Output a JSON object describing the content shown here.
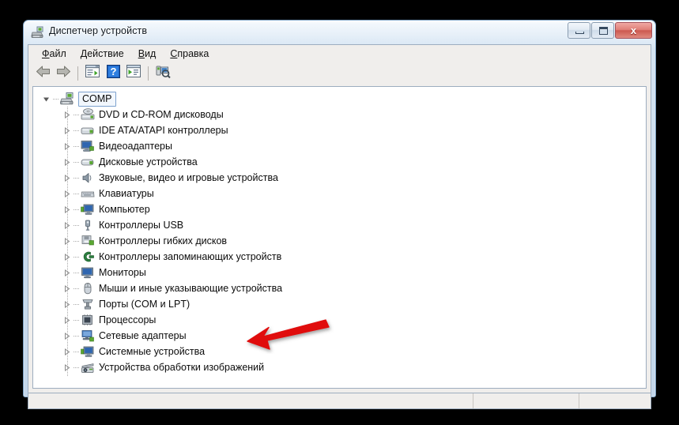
{
  "window": {
    "title": "Диспетчер устройств",
    "title_icon": "device-manager-icon",
    "buttons": {
      "minimize": "Свернуть",
      "maximize": "Развернуть",
      "close": "x"
    }
  },
  "menu": {
    "items": [
      {
        "label": "Файл",
        "accel": "Ф"
      },
      {
        "label": "Действие",
        "accel": "Д"
      },
      {
        "label": "Вид",
        "accel": "В"
      },
      {
        "label": "Справка",
        "accel": "С"
      }
    ]
  },
  "toolbar": {
    "items": [
      {
        "name": "back-button",
        "icon": "left-arrow-icon"
      },
      {
        "name": "forward-button",
        "icon": "right-arrow-icon"
      },
      {
        "name": "separator-1",
        "icon": "separator"
      },
      {
        "name": "properties-button",
        "icon": "properties-window-icon"
      },
      {
        "name": "help-button",
        "icon": "question-mark-icon"
      },
      {
        "name": "update-driver-button",
        "icon": "window-play-icon"
      },
      {
        "name": "separator-2",
        "icon": "separator"
      },
      {
        "name": "scan-hardware-changes-button",
        "icon": "scan-hardware-icon"
      }
    ]
  },
  "tree": {
    "root": {
      "label": "COMP",
      "icon": "computer-icon",
      "expanded": true,
      "selected": true
    },
    "children": [
      {
        "label": "DVD и CD-ROM дисководы",
        "icon": "dvd-drive-icon"
      },
      {
        "label": "IDE ATA/ATAPI контроллеры",
        "icon": "ide-controller-icon"
      },
      {
        "label": "Видеоадаптеры",
        "icon": "display-adapter-icon"
      },
      {
        "label": "Дисковые устройства",
        "icon": "disk-drive-icon"
      },
      {
        "label": "Звуковые, видео и игровые устройства",
        "icon": "sound-device-icon"
      },
      {
        "label": "Клавиатуры",
        "icon": "keyboard-icon"
      },
      {
        "label": "Компьютер",
        "icon": "computer-node-icon"
      },
      {
        "label": "Контроллеры USB",
        "icon": "usb-controller-icon"
      },
      {
        "label": "Контроллеры гибких дисков",
        "icon": "floppy-controller-icon"
      },
      {
        "label": "Контроллеры запоминающих устройств",
        "icon": "storage-controller-icon"
      },
      {
        "label": "Мониторы",
        "icon": "monitor-icon"
      },
      {
        "label": "Мыши и иные указывающие устройства",
        "icon": "mouse-icon"
      },
      {
        "label": "Порты (COM и LPT)",
        "icon": "ports-icon"
      },
      {
        "label": "Процессоры",
        "icon": "processor-icon"
      },
      {
        "label": "Сетевые адаптеры",
        "icon": "network-adapter-icon"
      },
      {
        "label": "Системные устройства",
        "icon": "system-device-icon"
      },
      {
        "label": "Устройства обработки изображений",
        "icon": "imaging-device-icon"
      }
    ]
  },
  "statusbar": {
    "pane1": "",
    "pane2": "",
    "pane3": ""
  },
  "annotation": {
    "type": "red-arrow",
    "color": "#E01010",
    "points_to": "Устройства обработки изображений"
  },
  "colors": {
    "accent": "#E01010",
    "titlebar": "#c2d8ef",
    "client_bg": "#f0eeec",
    "tree_bg": "#ffffff"
  }
}
